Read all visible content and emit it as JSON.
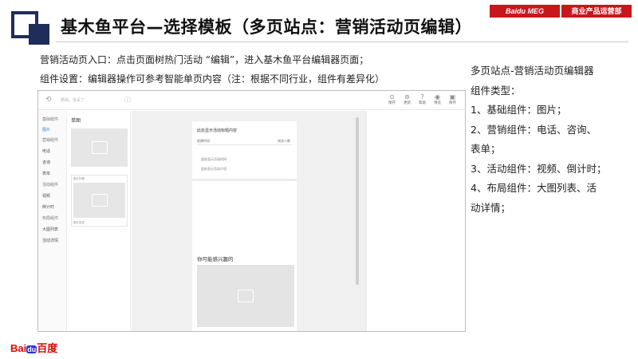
{
  "header": {
    "title": "基木鱼平台—选择模板（多页站点：营销活动页编辑）",
    "badge_brand": "Baidu MEG",
    "badge_dept": "商业产品运营部"
  },
  "intro": {
    "line1": "营销活动页入口：点击页面树热门活动 “编辑”，进入基木鱼平台编辑器页面；",
    "line2": "组件设置：编辑器操作可参考智能单页内容（注：根据不同行业，组件有差异化）"
  },
  "side_notes": {
    "heading": "多页站点-营销活动页编辑器",
    "subheading": "组件类型：",
    "item1": "1、基础组件：图片；",
    "item2a": "2、营销组件：电话、咨询、",
    "item2b": "表单；",
    "item3": "3、活动组件：视频、倒计时；",
    "item4a": "4、布局组件：大图列表、活",
    "item4b": "动详情；"
  },
  "editor": {
    "undo_placeholder": "撤销，批采了",
    "toolbar": [
      {
        "label": "保存",
        "icon": "save-icon"
      },
      {
        "label": "更新",
        "icon": "refresh-icon"
      },
      {
        "label": "帮助",
        "icon": "help-icon"
      },
      {
        "label": "预览",
        "icon": "preview-icon"
      },
      {
        "label": "保存",
        "icon": "disk-icon"
      }
    ],
    "nav": {
      "group_basic": "基础组件",
      "item_image": "图片",
      "group_marketing": "营销组件",
      "item_phone": "电话",
      "item_consult": "咨询",
      "item_form": "表单",
      "group_activity": "活动组件",
      "item_video": "视频",
      "item_countdown": "倒计时",
      "group_layout": "布局组件",
      "item_biglist": "大图列表",
      "item_detail": "活动详情"
    },
    "panel": {
      "title": "单图",
      "card_caption_top": "图片标题",
      "card_caption_bottom": "图片描述"
    },
    "phone": {
      "heading": "此处显示活动标题内容",
      "sub_left": "创建时间",
      "sub_right": "浏览人数",
      "time_text": "此处显示活动时间",
      "intro_text": "此处显示活动介绍",
      "like_title": "你可能感兴趣的"
    }
  },
  "logo": {
    "part1": "Bai",
    "paw": "du",
    "part2": "百度"
  },
  "colors": {
    "navy": "#1f2d5a",
    "brand_red": "#c8161d",
    "active_blue": "#3b7fe0"
  }
}
